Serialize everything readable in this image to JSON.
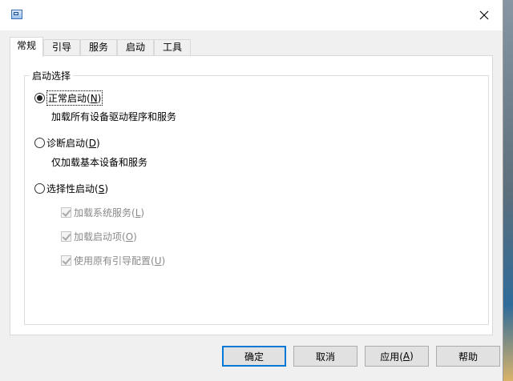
{
  "window": {
    "icon": "system-config-icon",
    "close_icon": "close-icon"
  },
  "tabs": [
    {
      "label": "常规",
      "active": true
    },
    {
      "label": "引导",
      "active": false
    },
    {
      "label": "服务",
      "active": false
    },
    {
      "label": "启动",
      "active": false
    },
    {
      "label": "工具",
      "active": false
    }
  ],
  "startup": {
    "group_title": "启动选择",
    "normal": {
      "label": "正常启动(N)",
      "label_main": "正常启动(",
      "accel": "N",
      "label_end": ")",
      "checked": true,
      "description": "加载所有设备驱动程序和服务"
    },
    "diagnostic": {
      "label_main": "诊断启动(",
      "accel": "D",
      "label_end": ")",
      "checked": false,
      "description": "仅加载基本设备和服务"
    },
    "selective": {
      "label_main": "选择性启动(",
      "accel": "S",
      "label_end": ")",
      "checked": false,
      "options": [
        {
          "label_main": "加载系统服务(",
          "accel": "L",
          "label_end": ")",
          "checked": true,
          "enabled": false
        },
        {
          "label_main": "加载启动项(",
          "accel": "O",
          "label_end": ")",
          "checked": true,
          "enabled": false
        },
        {
          "label_main": "使用原有引导配置(",
          "accel": "U",
          "label_end": ")",
          "checked": true,
          "enabled": false
        }
      ]
    }
  },
  "buttons": {
    "ok": "确定",
    "cancel": "取消",
    "apply_main": "应用(",
    "apply_accel": "A",
    "apply_end": ")",
    "help": "帮助"
  },
  "colors": {
    "default_button_border": "#0078d7",
    "window_bg": "#f0f0f0"
  }
}
